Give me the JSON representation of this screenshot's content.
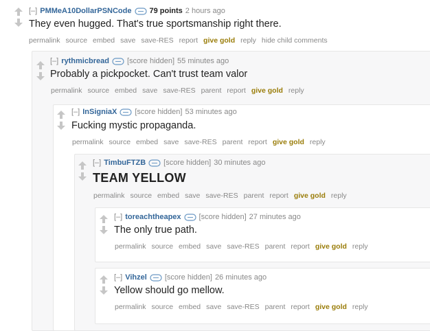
{
  "comments": [
    {
      "expand": "[–]",
      "author": "PMMeA10DollarPSNCode",
      "score": "79 points",
      "time": "2 hours ago",
      "body": "They even hugged. That's true sportsmanship right there.",
      "buttons": [
        "permalink",
        "source",
        "embed",
        "save",
        "save-RES",
        "report",
        "give gold",
        "reply",
        "hide child comments"
      ]
    },
    {
      "expand": "[–]",
      "author": "rythmicbread",
      "score": "[score hidden]",
      "time": "55 minutes ago",
      "body": "Probably a pickpocket. Can't trust team valor",
      "buttons": [
        "permalink",
        "source",
        "embed",
        "save",
        "save-RES",
        "parent",
        "report",
        "give gold",
        "reply"
      ]
    },
    {
      "expand": "[–]",
      "author": "InSigniaX",
      "score": "[score hidden]",
      "time": "53 minutes ago",
      "body": "Fucking mystic propaganda.",
      "buttons": [
        "permalink",
        "source",
        "embed",
        "save",
        "save-RES",
        "parent",
        "report",
        "give gold",
        "reply"
      ]
    },
    {
      "expand": "[–]",
      "author": "TimbuFTZB",
      "score": "[score hidden]",
      "time": "30 minutes ago",
      "body": "TEAM YELLOW",
      "buttons": [
        "permalink",
        "source",
        "embed",
        "save",
        "save-RES",
        "parent",
        "report",
        "give gold",
        "reply"
      ]
    },
    {
      "expand": "[–]",
      "author": "toreachtheapex",
      "score": "[score hidden]",
      "time": "27 minutes ago",
      "body": "The only true path.",
      "buttons": [
        "permalink",
        "source",
        "embed",
        "save",
        "save-RES",
        "parent",
        "report",
        "give gold",
        "reply"
      ]
    },
    {
      "expand": "[–]",
      "author": "Vihzel",
      "score": "[score hidden]",
      "time": "26 minutes ago",
      "body": "Yellow should go mellow.",
      "buttons": [
        "permalink",
        "source",
        "embed",
        "save",
        "save-RES",
        "parent",
        "report",
        "give gold",
        "reply"
      ]
    }
  ],
  "colors": {
    "author": "#336699",
    "gold": "#9a7d0a",
    "meta": "#888888",
    "arrow": "#c6c6c6"
  },
  "icons": {
    "upvote": "upvote-arrow-icon",
    "downvote": "downvote-arrow-icon",
    "message": "message-bubble-icon"
  }
}
